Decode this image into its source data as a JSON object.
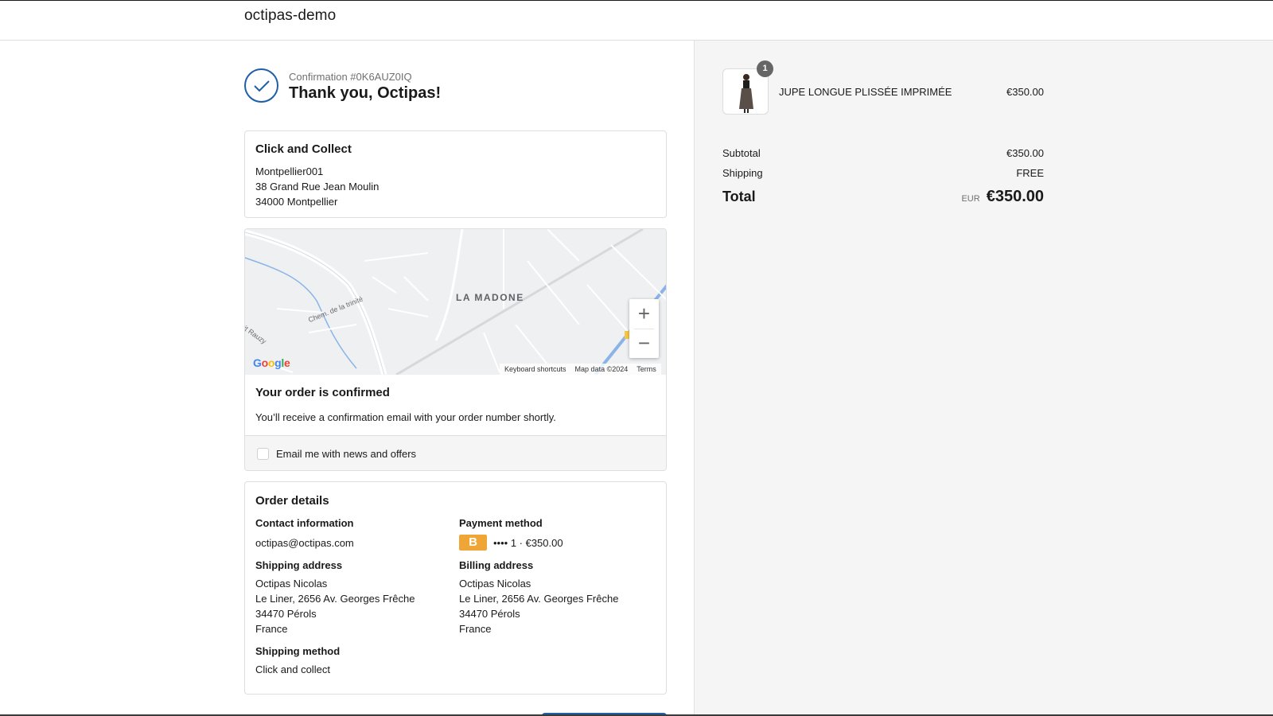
{
  "header": {
    "shop_name": "octipas-demo"
  },
  "confirmation": {
    "number": "Confirmation #0K6AUZ0IQ",
    "thank_you": "Thank you, Octipas!"
  },
  "pickup": {
    "title": "Click and Collect",
    "lines": [
      "Montpellier001",
      "38 Grand Rue Jean Moulin",
      "34000 Montpellier"
    ]
  },
  "map": {
    "area_label": "LA MADONE",
    "street_1": "Chem. de la trinité",
    "street_2": "tit Rauzy",
    "logo": [
      "G",
      "o",
      "o",
      "g",
      "l",
      "e"
    ],
    "keyboard_shortcuts": "Keyboard shortcuts",
    "map_data": "Map data ©2024",
    "terms": "Terms",
    "zoom_in": "+",
    "zoom_out": "−"
  },
  "order_status": {
    "title": "Your order is confirmed",
    "text": "You’ll receive a confirmation email with your order number shortly.",
    "email_opt_in": "Email me with news and offers"
  },
  "order_details": {
    "title": "Order details",
    "contact_label": "Contact information",
    "contact_value": "octipas@octipas.com",
    "shipping_address_label": "Shipping address",
    "shipping_address": [
      "Octipas Nicolas",
      "Le Liner, 2656 Av. Georges Frêche",
      "34470 Pérols",
      "France"
    ],
    "shipping_method_label": "Shipping method",
    "shipping_method": "Click and collect",
    "payment_label": "Payment method",
    "payment_badge": "B",
    "payment_text": "•••• 1 · €350.00",
    "billing_address_label": "Billing address",
    "billing_address": [
      "Octipas Nicolas",
      "Le Liner, 2656 Av. Georges Frêche",
      "34470 Pérols",
      "France"
    ]
  },
  "cart": {
    "item_name": "JUPE LONGUE PLISSÉE IMPRIMÉE",
    "item_price": "€350.00",
    "quantity": "1",
    "subtotal_label": "Subtotal",
    "subtotal": "€350.00",
    "shipping_label": "Shipping",
    "shipping": "FREE",
    "total_label": "Total",
    "currency": "EUR",
    "total": "€350.00"
  },
  "colors": {
    "accent": "#1f5fa8",
    "payment_badge": "#f0a637",
    "summary_bg": "#f5f5f5"
  }
}
